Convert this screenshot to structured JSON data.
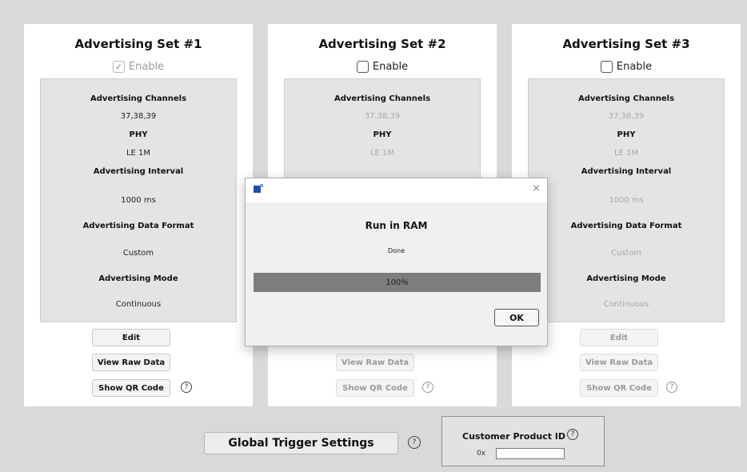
{
  "sets": [
    {
      "title": "Advertising Set #1",
      "enable_label": "Enable",
      "enabled": true,
      "channels_label": "Advertising Channels",
      "channels_value": "37,38,39",
      "phy_label": "PHY",
      "phy_value": "LE 1M",
      "interval_label": "Advertising Interval",
      "interval_value": "1000 ms",
      "format_label": "Advertising Data Format",
      "format_value": "Custom",
      "mode_label": "Advertising Mode",
      "mode_value": "Continuous",
      "edit_label": "Edit",
      "raw_label": "View Raw Data",
      "qr_label": "Show QR Code",
      "help": "?"
    },
    {
      "title": "Advertising Set #2",
      "enable_label": "Enable",
      "enabled": false,
      "channels_label": "Advertising Channels",
      "channels_value": "37,38,39",
      "phy_label": "PHY",
      "phy_value": "LE 1M",
      "raw_label": "View Raw Data",
      "qr_label": "Show QR Code",
      "help": "?"
    },
    {
      "title": "Advertising Set #3",
      "enable_label": "Enable",
      "enabled": false,
      "channels_label": "Advertising Channels",
      "channels_value": "37,38,39",
      "phy_label": "PHY",
      "phy_value": "LE 1M",
      "interval_label": "Advertising Interval",
      "interval_value": "1000 ms",
      "format_label": "Advertising Data Format",
      "format_value": "Custom",
      "mode_label": "Advertising Mode",
      "mode_value": "Continuous",
      "edit_label": "Edit",
      "raw_label": "View Raw Data",
      "qr_label": "Show QR Code",
      "help": "?"
    }
  ],
  "footer": {
    "global_trigger_label": "Global Trigger Settings",
    "help": "?",
    "customer_product_id_label": "Customer Product ID",
    "hex_prefix": "0x",
    "customer_product_id_value": ""
  },
  "dialog": {
    "heading": "Run in RAM",
    "status": "Done",
    "progress_percent": 100,
    "progress_text": "100%",
    "ok_label": "OK",
    "close_glyph": "×"
  },
  "check_glyph": "✓"
}
